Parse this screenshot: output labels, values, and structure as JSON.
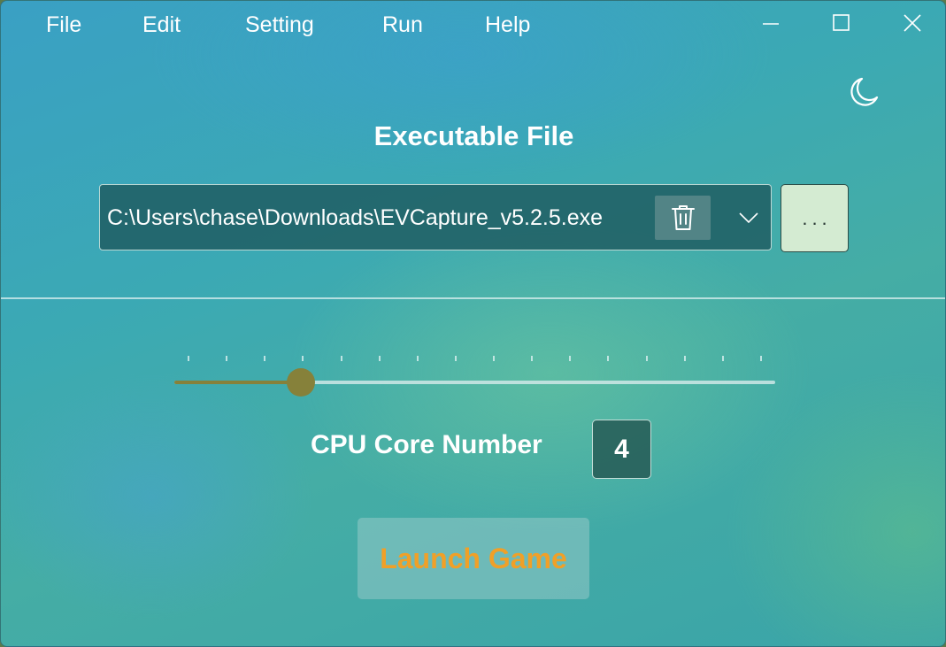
{
  "menu": {
    "items": [
      "File",
      "Edit",
      "Setting",
      "Run",
      "Help"
    ]
  },
  "window_controls": {
    "minimize": "minimize-icon",
    "maximize": "maximize-icon",
    "close": "close-icon"
  },
  "theme_toggle": {
    "icon": "moon-icon"
  },
  "executable": {
    "title": "Executable File",
    "path": "C:\\Users\\chase\\Downloads\\EVCapture_v5.2.5.exe",
    "clear_icon": "trash-icon",
    "dropdown_icon": "chevron-down-icon",
    "browse_label": "..."
  },
  "cpu": {
    "slider_fraction": 0.21,
    "tick_count": 16,
    "label": "CPU Core Number",
    "value": "4"
  },
  "launch": {
    "label": "Launch Game"
  },
  "colors": {
    "slider_active": "#86813a",
    "launch_text": "#f0a028",
    "browse_bg": "#d4ebd2"
  }
}
